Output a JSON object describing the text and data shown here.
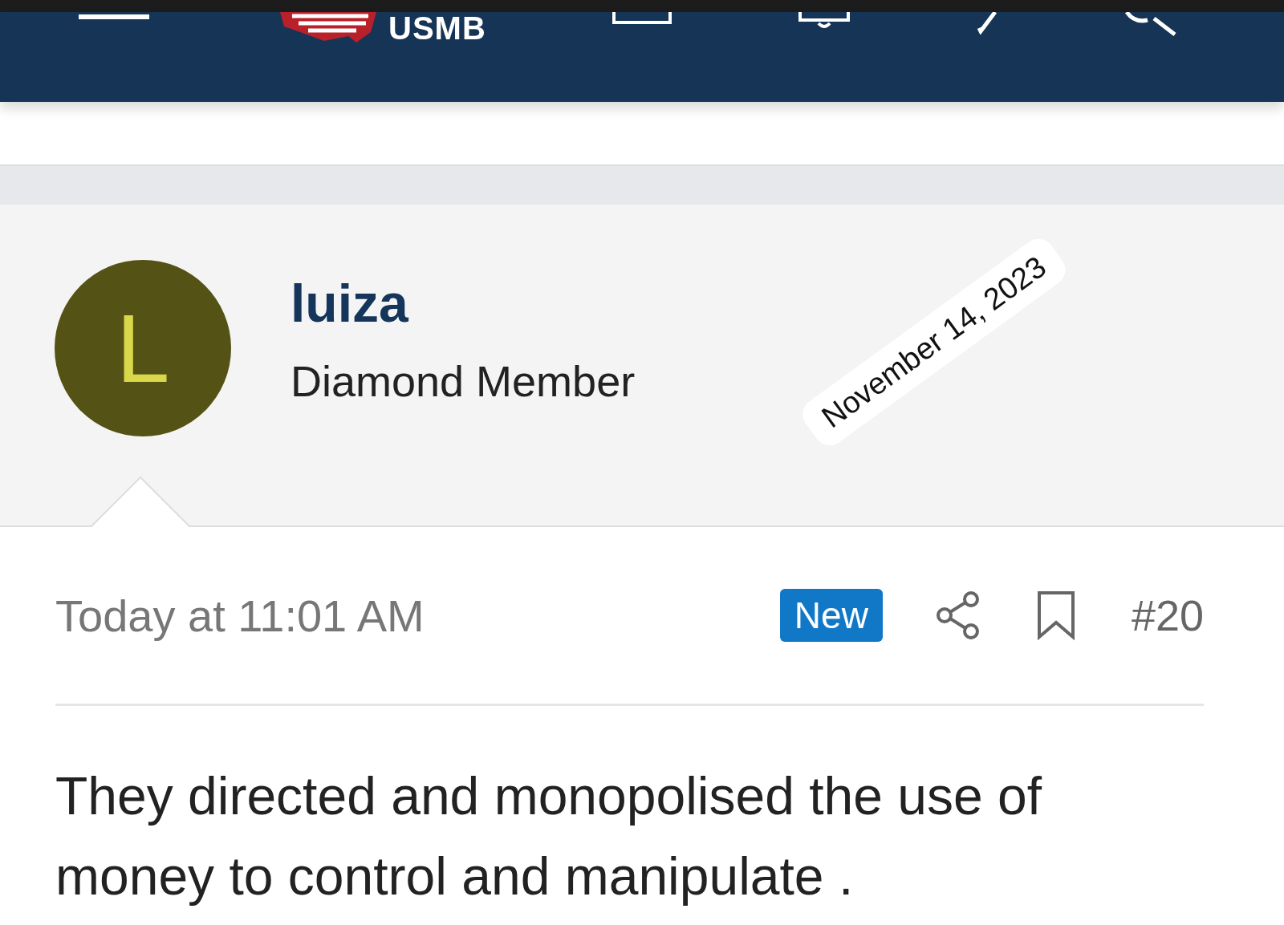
{
  "header": {
    "logo": "USMB"
  },
  "post": {
    "author": {
      "initial": "L",
      "name": "luiza",
      "title": "Diamond Member"
    },
    "date_stamp": "November 14, 2023",
    "time": "Today at 11:01 AM",
    "badge": "New",
    "number": "#20",
    "body": "They directed and monopolised the use of money to control and manipulate ."
  }
}
